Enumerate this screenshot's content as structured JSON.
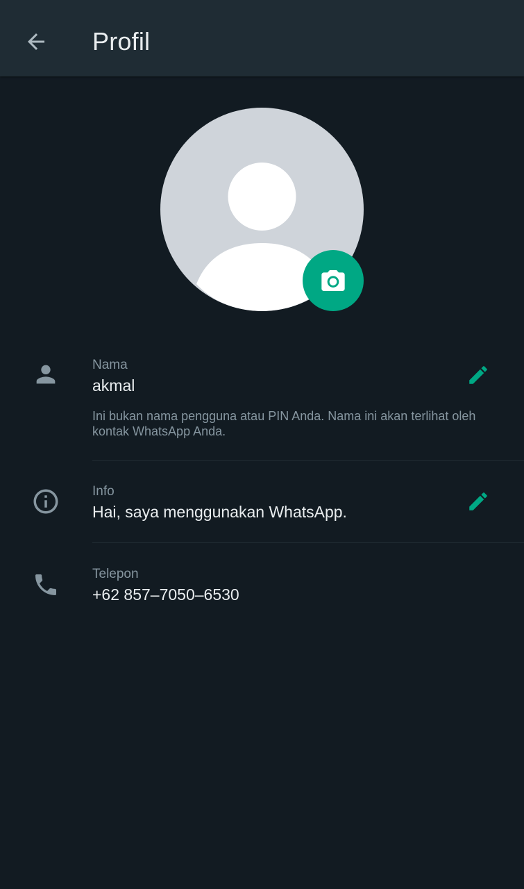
{
  "appbar": {
    "title": "Profil",
    "back_icon": "arrow-back-icon"
  },
  "avatar": {
    "placeholder_icon": "default-avatar-icon",
    "camera_icon": "camera-icon",
    "accent_color": "#00a884"
  },
  "name_row": {
    "icon": "person-icon",
    "label": "Nama",
    "value": "akmal",
    "hint": "Ini bukan nama pengguna atau PIN Anda. Nama ini akan terlihat oleh kontak WhatsApp Anda.",
    "edit_icon": "pencil-icon"
  },
  "about_row": {
    "icon": "info-icon",
    "label": "Info",
    "value": "Hai, saya menggunakan WhatsApp.",
    "edit_icon": "pencil-icon"
  },
  "phone_row": {
    "icon": "phone-icon",
    "label": "Telepon",
    "value": "+62 857–7050–6530"
  },
  "colors": {
    "background": "#121b22",
    "appbar": "#1f2c34",
    "primary_text": "#e9edef",
    "secondary_text": "#8696a0",
    "accent": "#00a884"
  }
}
